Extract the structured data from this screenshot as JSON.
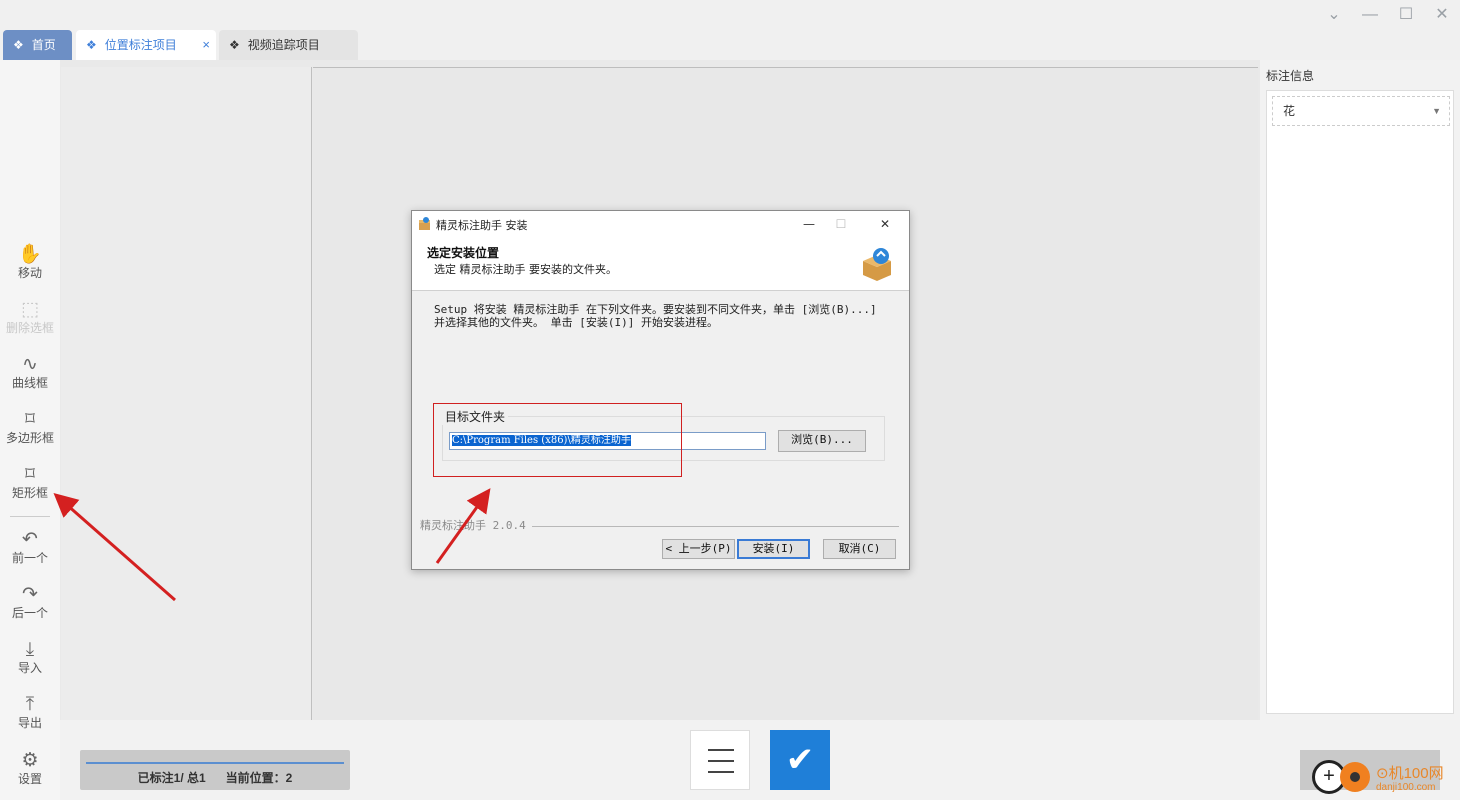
{
  "tabs": [
    {
      "label": "首页",
      "icon": "diamond-grid-icon"
    },
    {
      "label": "位置标注项目",
      "icon": "diamond-grid-icon",
      "close": "×"
    },
    {
      "label": "视频追踪项目",
      "icon": "diamond-grid-icon"
    }
  ],
  "window_controls": {
    "chevron": "⌄",
    "minimize": "—",
    "maximize": "☐",
    "close": "✕"
  },
  "tools": [
    {
      "label": "移动",
      "icon": "hand-icon",
      "glyph": "✋"
    },
    {
      "label": "删除选框",
      "icon": "delete-box-icon",
      "glyph": "⬚"
    },
    {
      "label": "曲线框",
      "icon": "curve-icon",
      "glyph": "∿"
    },
    {
      "label": "多边形框",
      "icon": "polygon-icon",
      "glyph": "⌑"
    },
    {
      "label": "矩形框",
      "icon": "rectangle-icon",
      "glyph": "⌑"
    },
    {
      "label": "前一个",
      "icon": "undo-arrow-icon",
      "glyph": "↶"
    },
    {
      "label": "后一个",
      "icon": "redo-arrow-icon",
      "glyph": "↷"
    },
    {
      "label": "导入",
      "icon": "import-icon",
      "glyph": "⤓"
    },
    {
      "label": "导出",
      "icon": "export-icon",
      "glyph": "⤒"
    },
    {
      "label": "设置",
      "icon": "gear-icon",
      "glyph": "⚙"
    }
  ],
  "annotation_panel": {
    "title": "标注信息",
    "selected": "花",
    "caret": "▼"
  },
  "status": {
    "annotated": "已标注1/ 总1",
    "position": "当前位置：2"
  },
  "confirm_glyph": "✔",
  "dialog": {
    "title": "精灵标注助手 安装",
    "heading": "选定安装位置",
    "subheading": "选定 精灵标注助手 要安装的文件夹。",
    "description": "Setup 将安装 精灵标注助手 在下列文件夹。要安装到不同文件夹，单击 [浏览(B)...] 并选择其他的文件夹。 单击 [安装(I)] 开始安装进程。",
    "group_label": "目标文件夹",
    "path": "C:\\Program Files (x86)\\精灵标注助手",
    "browse_label": "浏览(B)...",
    "version": "精灵标注助手 2.0.4",
    "back_label": "< 上一步(P)",
    "install_label": "安装(I)",
    "cancel_label": "取消(C)",
    "controls": {
      "minimize": "—",
      "maximize": "☐",
      "close": "✕"
    }
  },
  "watermark": {
    "text1": "⊙机100网",
    "text2": "danji100.com"
  },
  "colors": {
    "accent": "#1f7fd8",
    "tab_active": "#6d8fc5",
    "annotation_arrow": "#d42020"
  }
}
